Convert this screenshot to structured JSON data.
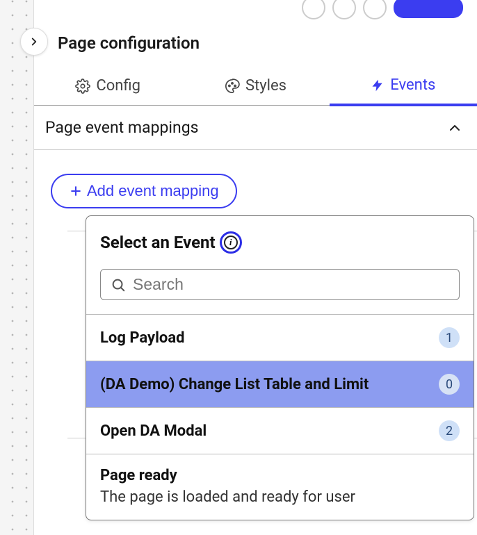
{
  "header": {
    "title": "Page configuration"
  },
  "tabs": [
    {
      "label": "Config",
      "icon": "gear-icon",
      "active": false
    },
    {
      "label": "Styles",
      "icon": "palette-icon",
      "active": false
    },
    {
      "label": "Events",
      "icon": "bolt-icon",
      "active": true
    }
  ],
  "section": {
    "title": "Page event mappings",
    "add_button": "Add event mapping"
  },
  "dropdown": {
    "title": "Select an Event",
    "search_placeholder": "Search",
    "events": [
      {
        "name": "Log Payload",
        "count": "1",
        "selected": false
      },
      {
        "name": "(DA Demo) Change List Table and Limit",
        "count": "0",
        "selected": true
      },
      {
        "name": "Open DA Modal",
        "count": "2",
        "selected": false
      },
      {
        "name": "Page ready",
        "description": "The page is loaded and ready for user",
        "selected": false
      }
    ]
  }
}
